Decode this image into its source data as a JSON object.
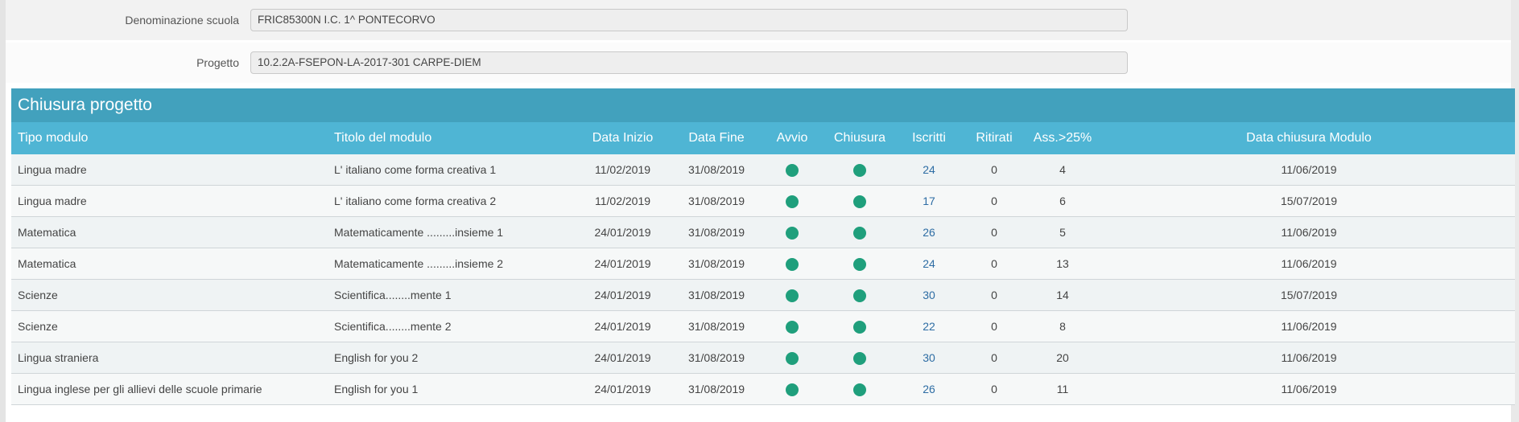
{
  "fields": {
    "school_label": "Denominazione scuola",
    "school_value": "FRIC85300N I.C. 1^ PONTECORVO",
    "project_label": "Progetto",
    "project_value": "10.2.2A-FSEPON-LA-2017-301 CARPE-DIEM"
  },
  "panel": {
    "title": "Chiusura progetto"
  },
  "table": {
    "headers": {
      "tipo": "Tipo modulo",
      "titolo": "Titolo del modulo",
      "inizio": "Data Inizio",
      "fine": "Data Fine",
      "avvio": "Avvio",
      "chiusura": "Chiusura",
      "iscritti": "Iscritti",
      "ritirati": "Ritirati",
      "ass": "Ass.>25%",
      "data_chiusura": "Data chiusura Modulo"
    },
    "status_color": "#1f9f7c",
    "rows": [
      {
        "tipo": "Lingua madre",
        "titolo": "L' italiano come forma creativa 1",
        "inizio": "11/02/2019",
        "fine": "31/08/2019",
        "avvio": "green-dot",
        "chiusura": "green-dot",
        "iscritti": "24",
        "ritirati": "0",
        "ass": "4",
        "data_chiusura": "11/06/2019"
      },
      {
        "tipo": "Lingua madre",
        "titolo": "L' italiano come forma creativa 2",
        "inizio": "11/02/2019",
        "fine": "31/08/2019",
        "avvio": "green-dot",
        "chiusura": "green-dot",
        "iscritti": "17",
        "ritirati": "0",
        "ass": "6",
        "data_chiusura": "15/07/2019"
      },
      {
        "tipo": "Matematica",
        "titolo": "Matematicamente .........insieme 1",
        "inizio": "24/01/2019",
        "fine": "31/08/2019",
        "avvio": "green-dot",
        "chiusura": "green-dot",
        "iscritti": "26",
        "ritirati": "0",
        "ass": "5",
        "data_chiusura": "11/06/2019"
      },
      {
        "tipo": "Matematica",
        "titolo": "Matematicamente .........insieme 2",
        "inizio": "24/01/2019",
        "fine": "31/08/2019",
        "avvio": "green-dot",
        "chiusura": "green-dot",
        "iscritti": "24",
        "ritirati": "0",
        "ass": "13",
        "data_chiusura": "11/06/2019"
      },
      {
        "tipo": "Scienze",
        "titolo": "Scientifica........mente 1",
        "inizio": "24/01/2019",
        "fine": "31/08/2019",
        "avvio": "green-dot",
        "chiusura": "green-dot",
        "iscritti": "30",
        "ritirati": "0",
        "ass": "14",
        "data_chiusura": "15/07/2019"
      },
      {
        "tipo": "Scienze",
        "titolo": "Scientifica........mente 2",
        "inizio": "24/01/2019",
        "fine": "31/08/2019",
        "avvio": "green-dot",
        "chiusura": "green-dot",
        "iscritti": "22",
        "ritirati": "0",
        "ass": "8",
        "data_chiusura": "11/06/2019"
      },
      {
        "tipo": "Lingua straniera",
        "titolo": "English for you 2",
        "inizio": "24/01/2019",
        "fine": "31/08/2019",
        "avvio": "green-dot",
        "chiusura": "green-dot",
        "iscritti": "30",
        "ritirati": "0",
        "ass": "20",
        "data_chiusura": "11/06/2019"
      },
      {
        "tipo": "Lingua inglese per gli allievi delle scuole primarie",
        "titolo": "English for you 1",
        "inizio": "24/01/2019",
        "fine": "31/08/2019",
        "avvio": "green-dot",
        "chiusura": "green-dot",
        "iscritti": "26",
        "ritirati": "0",
        "ass": "11",
        "data_chiusura": "11/06/2019"
      }
    ]
  }
}
